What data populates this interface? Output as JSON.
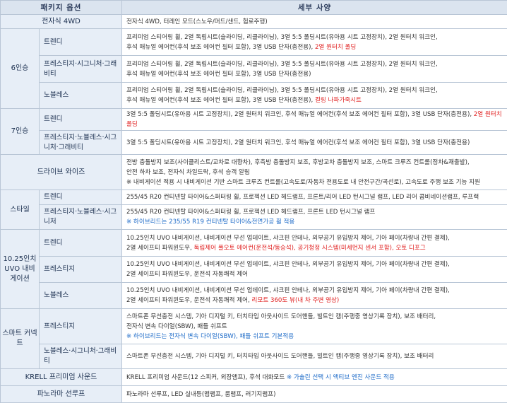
{
  "header": {
    "col1": "패키지 옵션",
    "col2": "세부 사양"
  },
  "rows": {
    "awd": {
      "group": "전자식 4WD",
      "desc": "전자식 4WD, 터레인 모드(스노우/머드/샌드, 험로주행)"
    },
    "six": {
      "group": "6인승",
      "trendy": {
        "name": "트렌디",
        "l1": "프리미엄 스티어링 휠, 2열 독립시트(슬라이딩, 리클라이닝), 3열 5:5 폴딩시트(유아용 시트 고정장치), 2열 원터치 워크인,",
        "l2a": "후석 매뉴얼 에어컨(후석 보조 에어컨 필터 포함), 3열 USB 단자(충전용), ",
        "l2b": "2열 원터치 폴딩"
      },
      "prestige": {
        "name": "프레스티지·시그니처·그래비티",
        "l1": "프리미엄 스티어링 휠, 2열 독립시트(슬라이딩, 리클라이닝), 3열 5:5 폴딩시트(유아용 시트 고정장치), 2열 원터치 워크인,",
        "l2": "후석 매뉴얼 에어컨(후석 보조 에어컨 필터 포함), 3열 USB 단자(충전용)"
      },
      "noblesse": {
        "name": "노블레스",
        "l1": "프리미엄 스티어링 휠, 2열 독립시트(슬라이딩, 리클라이닝), 3열 5:5 폴딩시트(유아용 시트 고정장치), 2열 원터치 워크인,",
        "l2a": "후석 매뉴얼 에어컨(후석 보조 에어컨 필터 포함), 3열 USB 단자(충전용), ",
        "l2b": "컬링 나파가죽시트"
      }
    },
    "seven": {
      "group": "7인승",
      "trendy": {
        "name": "트렌디",
        "la": "3열 5:5 폴딩시트(유아용 시트 고정장치), 2열 원터치 워크인, 후석 매뉴얼 에어컨(후석 보조 에어컨 필터 포함), 3열 USB 단자(충전용), ",
        "lb": "2열 원터치 폴딩"
      },
      "prestige": {
        "name": "프레스티지·노블레스·시그니처·그래비티",
        "l": "3열 5:5 폴딩시트(유아용 시트 고정장치), 2열 원터치 워크인, 후석 매뉴얼 에어컨(후석 보조 에어컨 필터 포함), 3열 USB 단자(충전용)"
      }
    },
    "drive": {
      "group": "드라이브 와이즈",
      "l1": "전방 충돌방지 보조(사이클리스트/교차로 대향차), 후측방 충돌방지 보조, 후방교차 충돌방지 보조, 스마트 크루즈 컨트롤(정차&재출발),",
      "l2": "안전 하차 보조, 전자식 차일드락, 후석 승객 알림",
      "l3": "※ 내비게이션 적용 시 내비게이션 기반 스마트 크루즈 컨트롤(고속도로/자동차 전용도로 내 안전구간/곡선로), 고속도로 주행 보조 기능 지원"
    },
    "style": {
      "group": "스타일",
      "trendy": {
        "name": "트렌디",
        "l": "255/45 R20 컨티넨탈 타이어&스퍼터링 휠, 프로젝션 LED 헤드램프, 프론트/리어 LED 턴시그널 램프, LED 리어 콤비네이션램프, 루프랙"
      },
      "prestige": {
        "name": "프레스티지·노블레스·시그니처",
        "l1": "255/45 R20 컨티넨탈 타이어&스퍼터링 휠, 프로젝션 LED 헤드램프, 프론트 LED 턴시그널 램프",
        "l2": "※ 하이브리드는 235/55 R19 컨티넨탈 타이어&전면가공 휠 적용"
      }
    },
    "nav": {
      "group": "10.25인치 UVO 내비게이션",
      "trendy": {
        "name": "트렌디",
        "l1": "10.25인치 UVO 내비게이션, 내비게이션 무선 업데이트, 샤크핀 안테나, 외부공기 유입방지 제어, 기아 페이(차량내 간편 결제),",
        "l2a": "2열 세이프티 파워윈도우, ",
        "l2b": "독립제어 풀오토 에어컨(운전석/동승석), 공기청정 시스템(미세먼지 센서 포함), 오토 디포그"
      },
      "prestige": {
        "name": "프레스티지",
        "l1": "10.25인치 UVO 내비게이션, 내비게이션 무선 업데이트, 샤크핀 안테나, 외부공기 유입방지 제어, 기아 페이(차량내 간편 결제),",
        "l2": "2열 세이프티 파워윈도우, 운전석 자동쾌적 제어"
      },
      "noblesse": {
        "name": "노블레스",
        "l1": "10.25인치 UVO 내비게이션, 내비게이션 무선 업데이트, 샤크핀 안테나, 외부공기 유입방지 제어, 기아 페이(차량내 간편 결제),",
        "l2a": "2열 세이프티 파워윈도우, 운전석 자동쾌적 제어, ",
        "l2b": "리모트 360도 뷰(내 차 주변 영상)"
      }
    },
    "smart": {
      "group": "스마트 커넥트",
      "prestige": {
        "name": "프레스티지",
        "l1": "스마트폰 무선충전 시스템, 기아 디지털 키, 터치타입 아웃사이드 도어핸들, 빌트인 캠(주행중 영상기록 장치), 보조 배터리,",
        "l2": "전자식 변속 다이얼(SBW), 패들 쉬프트",
        "l3": "※ 하이브리드는 전자식 변속 다이얼(SBW), 패들 쉬프트 기본적용"
      },
      "noblesse": {
        "name": "노블레스·시그니처·그래비티",
        "l": "스마트폰 무선충전 시스템, 기아 디지털 키, 터치타입 아웃사이드 도어핸들, 빌트인 캠(주행중 영상기록 장치), 보조 배터리"
      }
    },
    "krell": {
      "group": "KRELL 프리미엄 사운드",
      "la": "KRELL 프리미엄 사운드(12 스피커, 외장앰프), 후석 대화모드 ",
      "lb": "※ 가솔린 선택 시 액티브 엔진 사운드 적용"
    },
    "pano": {
      "group": "파노라마 선루프",
      "l": "파노라마 선루프, LED 실내등(맵램프, 룸램프, 러기지램프)"
    }
  }
}
